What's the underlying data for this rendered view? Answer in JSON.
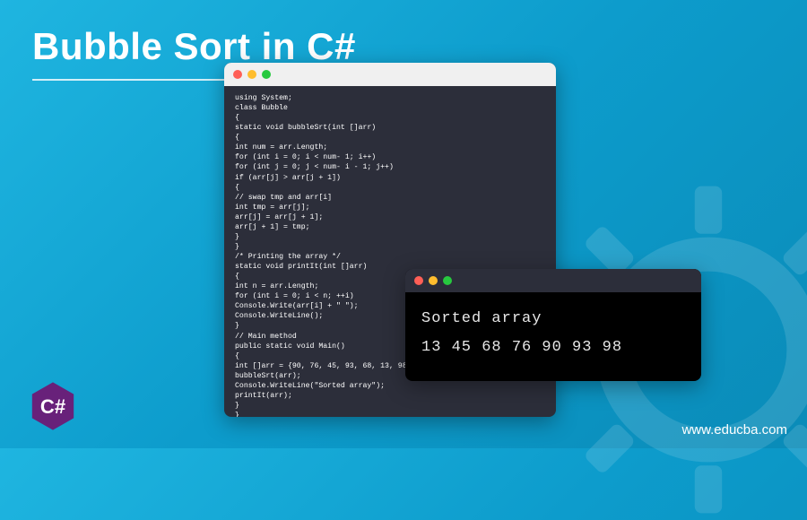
{
  "title": "Bubble Sort in C#",
  "code_window": {
    "lines": [
      "using System;",
      "class Bubble",
      "{",
      "static void bubbleSrt(int []arr)",
      "{",
      "int num = arr.Length;",
      "for (int i = 0; i < num- 1; i++)",
      "for (int j = 0; j < num- i - 1; j++)",
      "if (arr[j] > arr[j + 1])",
      "{",
      "// swap tmp and arr[i]",
      "int tmp = arr[j];",
      "arr[j] = arr[j + 1];",
      "arr[j + 1] = tmp;",
      "}",
      "}",
      "/* Printing the array */",
      "static void printIt(int []arr)",
      "{",
      "int n = arr.Length;",
      "for (int i = 0; i < n; ++i)",
      "Console.Write(arr[i] + \" \");",
      "Console.WriteLine();",
      "}",
      "// Main method",
      "public static void Main()",
      "{",
      "int []arr = {90, 76, 45, 93, 68, 13, 98};",
      "bubbleSrt(arr);",
      "Console.WriteLine(\"Sorted array\");",
      "printIt(arr);",
      "}",
      "}"
    ]
  },
  "output_window": {
    "line1": "Sorted array",
    "line2": "13  45  68  76  90  93  98"
  },
  "badge": {
    "label": "C#",
    "color": "#68217a"
  },
  "footer_url": "www.educba.com"
}
